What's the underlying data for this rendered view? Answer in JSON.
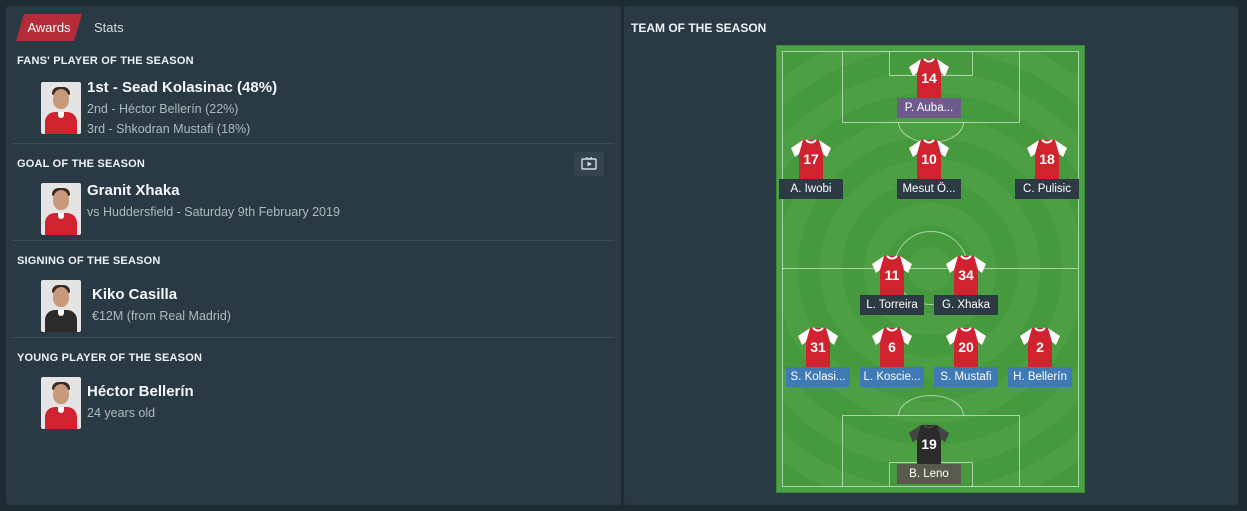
{
  "tabs": {
    "awards": "Awards",
    "stats": "Stats"
  },
  "fans_player": {
    "title": "FANS' PLAYER OF THE SEASON",
    "first": "1st - Sead Kolasinac (48%)",
    "second": "2nd - Héctor Bellerín (22%)",
    "third": "3rd - Shkodran Mustafi (18%)"
  },
  "goal": {
    "title": "GOAL OF THE SEASON",
    "name": "Granit Xhaka",
    "detail": "vs Huddersfield - Saturday 9th February 2019"
  },
  "signing": {
    "title": "SIGNING OF THE SEASON",
    "name": "Kiko Casilla",
    "detail": "€12M (from Real Madrid)"
  },
  "young": {
    "title": "YOUNG PLAYER OF THE SEASON",
    "name": "Héctor Bellerín",
    "detail": "24 years old"
  },
  "tots": {
    "title": "TEAM OF THE SEASON",
    "players": [
      {
        "num": "14",
        "name": "P. Auba...",
        "role": "att"
      },
      {
        "num": "17",
        "name": "A. Iwobi",
        "role": "mid"
      },
      {
        "num": "10",
        "name": "Mesut Ö...",
        "role": "mid"
      },
      {
        "num": "18",
        "name": "C. Pulisic",
        "role": "mid"
      },
      {
        "num": "11",
        "name": "L. Torreira",
        "role": "mid"
      },
      {
        "num": "34",
        "name": "G. Xhaka",
        "role": "mid"
      },
      {
        "num": "31",
        "name": "S. Kolasi...",
        "role": "def"
      },
      {
        "num": "6",
        "name": "L. Koscie...",
        "role": "def"
      },
      {
        "num": "20",
        "name": "S. Mustafi",
        "role": "def"
      },
      {
        "num": "2",
        "name": "H. Bellerín",
        "role": "def"
      },
      {
        "num": "19",
        "name": "B. Leno",
        "role": "gk"
      }
    ]
  },
  "colors": {
    "accent": "#b52b38",
    "pitch": "#4aa342",
    "shirt_red": "#d0222f",
    "gk_shirt": "#2b2b2b"
  }
}
